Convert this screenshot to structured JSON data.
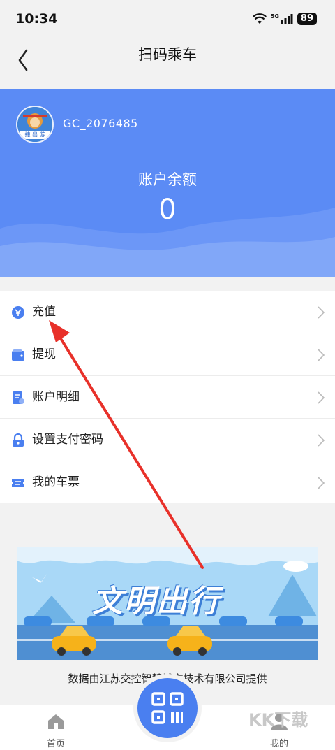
{
  "status": {
    "time": "10:34",
    "battery": "89",
    "network": "5G"
  },
  "nav": {
    "title": "扫码乘车",
    "back_icon": "chevron-left-icon"
  },
  "account": {
    "username": "GC_2076485",
    "balance_label": "账户余额",
    "balance_value": "0",
    "avatar_caption": "捷 出 游"
  },
  "colors": {
    "hero": "#5b8bf5",
    "accent": "#4a7ff0",
    "arrow": "#e8312a"
  },
  "menu": [
    {
      "label": "充值",
      "icon": "recharge-icon"
    },
    {
      "label": "提现",
      "icon": "wallet-icon"
    },
    {
      "label": "账户明细",
      "icon": "statement-icon"
    },
    {
      "label": "设置支付密码",
      "icon": "lock-icon"
    },
    {
      "label": "我的车票",
      "icon": "ticket-icon"
    }
  ],
  "banner": {
    "text": "文明出行"
  },
  "footer": {
    "provider": "数据由江苏交控智慧城市技术有限公司提供"
  },
  "tabbar": {
    "home_label": "首页",
    "mine_label": "我的",
    "scan_icon": "qr-scan-icon"
  },
  "watermark": "KK下载"
}
